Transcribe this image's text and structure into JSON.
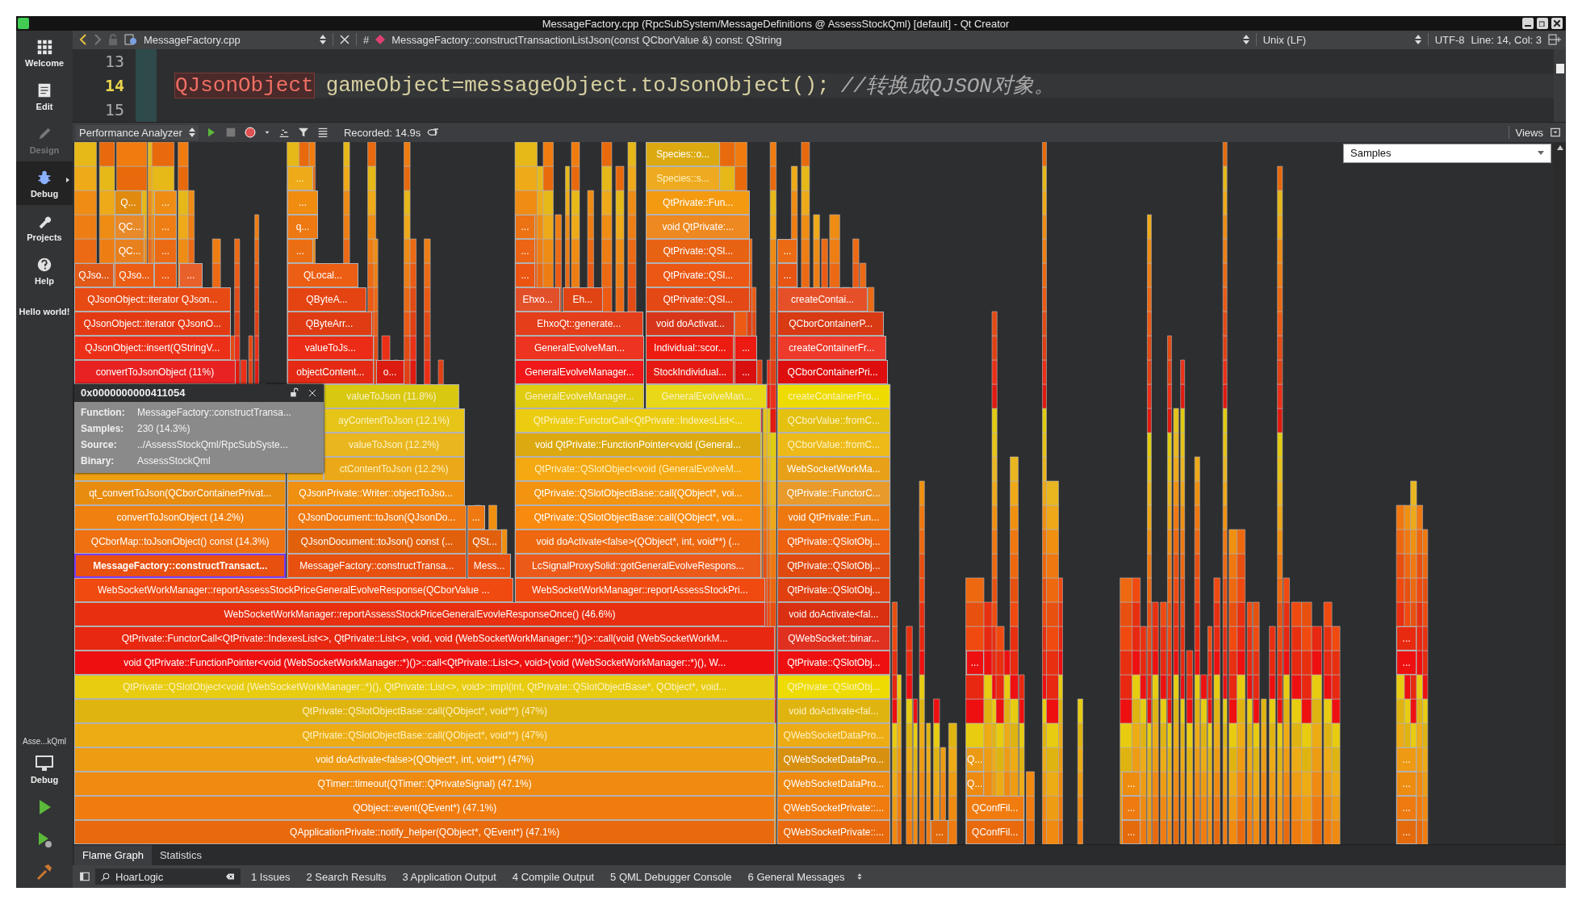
{
  "window": {
    "title": "MessageFactory.cpp (RpcSubSystem/MessageDefinitions @ AssessStockQml) [default] - Qt Creator"
  },
  "mode_bar": {
    "items": [
      {
        "label": "Welcome",
        "selected": false,
        "disabled": false
      },
      {
        "label": "Edit",
        "selected": false,
        "disabled": false
      },
      {
        "label": "Design",
        "selected": false,
        "disabled": true
      },
      {
        "label": "Debug",
        "selected": true,
        "disabled": false
      },
      {
        "label": "Projects",
        "selected": false,
        "disabled": false
      },
      {
        "label": "Help",
        "selected": false,
        "disabled": false
      }
    ],
    "note": "Hello world!",
    "target": {
      "project": "Asse...kQml",
      "config": "Debug"
    }
  },
  "editor_toolbar": {
    "file": "MessageFactory.cpp",
    "hash": "#",
    "symbol": "MessageFactory::constructTransactionListJson(const QCborValue &) const: QString",
    "line_ending": "Unix (LF)",
    "encoding": "UTF-8",
    "position": "Line: 14, Col: 3"
  },
  "code": {
    "lines": [
      {
        "number": "13",
        "current": false
      },
      {
        "number": "14",
        "current": true,
        "tokens": [
          {
            "kind": "type",
            "text": "QJsonObject"
          },
          {
            "kind": "plain",
            "text": "gameObject=messageObject.toJsonObject();"
          },
          {
            "kind": "comment",
            "text": "//转换成QJSON对象。"
          }
        ]
      },
      {
        "number": "15",
        "current": false
      }
    ]
  },
  "perf_toolbar": {
    "tool": "Performance Analyzer",
    "recorded": "Recorded: 14.9s",
    "views": "Views"
  },
  "flame_graph": {
    "mode": "Samples",
    "rows": [
      {
        "frames": [
          {
            "label": "Species::o...",
            "color": "#dcaa10",
            "selected": false
          }
        ]
      },
      {
        "frames": [
          {
            "label": "...",
            "color": "#eeaa18",
            "selected": false
          },
          {
            "label": "Species::s...",
            "color": "#eeaa20",
            "selected": false
          }
        ]
      },
      {
        "frames": [
          {
            "label": "Q...",
            "color": "#e08a10",
            "selected": false
          },
          {
            "label": "...",
            "color": "#ee8c14",
            "selected": false
          },
          {
            "label": "...",
            "color": "#f08c10",
            "selected": false
          },
          {
            "label": "QtPrivate::Fun...",
            "color": "#f49a10",
            "selected": false
          }
        ]
      },
      {
        "frames": [
          {
            "label": "QC...",
            "color": "#e88a2a",
            "selected": false
          },
          {
            "label": "...",
            "color": "#ee7e14",
            "selected": false
          },
          {
            "label": "q...",
            "color": "#ee7812",
            "selected": false
          },
          {
            "label": "...",
            "color": "#ec7214",
            "selected": false
          },
          {
            "label": "void QtPrivate:...",
            "color": "#ee8820",
            "selected": false
          }
        ]
      },
      {
        "frames": [
          {
            "label": "QC...",
            "color": "#e8801e",
            "selected": false
          },
          {
            "label": "...",
            "color": "#ec6a14",
            "selected": false
          },
          {
            "label": "...",
            "color": "#ec6e12",
            "selected": false
          },
          {
            "label": "...",
            "color": "#ec6414",
            "selected": false
          },
          {
            "label": "QtPrivate::QSl...",
            "color": "#e86214",
            "selected": false
          },
          {
            "label": "...",
            "color": "#ec6a14",
            "selected": false
          }
        ]
      },
      {
        "frames": [
          {
            "label": "QJso...",
            "color": "#e25a18",
            "selected": false
          },
          {
            "label": "QJso...",
            "color": "#ec5e14",
            "selected": false
          },
          {
            "label": "...",
            "color": "#ec5a14",
            "selected": false
          },
          {
            "label": "...",
            "color": "#e8602a",
            "selected": false
          },
          {
            "label": "QLocal...",
            "color": "#ec5e14",
            "selected": false
          },
          {
            "label": "...",
            "color": "#ec5412",
            "selected": false
          },
          {
            "label": "QtPrivate::QSl...",
            "color": "#ec5814",
            "selected": false
          },
          {
            "label": "...",
            "color": "#e85414",
            "selected": false
          }
        ]
      },
      {
        "frames": [
          {
            "label": "QJsonObject::iterator QJson...",
            "color": "#e84a14",
            "selected": false
          },
          {
            "label": "QByteA...",
            "color": "#e44412",
            "selected": false
          },
          {
            "label": "Ehxo...",
            "color": "#e2502a",
            "selected": false
          },
          {
            "label": "Eh...",
            "color": "#e04414",
            "selected": false
          },
          {
            "label": "QtPrivate::QSl...",
            "color": "#e44814",
            "selected": false
          },
          {
            "label": "createContai...",
            "color": "#e65028",
            "selected": false
          }
        ]
      },
      {
        "frames": [
          {
            "label": "QJsonObject::iterator QJsonO...",
            "color": "#e43a14",
            "selected": false
          },
          {
            "label": "QByteArr...",
            "color": "#e03c14",
            "selected": false
          },
          {
            "label": "EhxoQt::generate...",
            "color": "#e43e1a",
            "selected": false
          },
          {
            "label": "void doActivat...",
            "color": "#d8361a",
            "selected": false
          },
          {
            "label": "QCborContainerP...",
            "color": "#d83a14",
            "selected": false
          }
        ]
      },
      {
        "frames": [
          {
            "label": "QJsonObject::insert(QStringV...",
            "color": "#ec3018",
            "selected": false
          },
          {
            "label": "valueToJs...",
            "color": "#ec2c16",
            "selected": false
          },
          {
            "label": "GeneralEvolveMan...",
            "color": "#ec3420",
            "selected": false
          },
          {
            "label": "Individual::scor...",
            "color": "#ec1c10",
            "selected": false
          },
          {
            "label": "...",
            "color": "#ec1a10",
            "selected": false
          },
          {
            "label": "createContainerFr...",
            "color": "#ee3a2a",
            "selected": false
          }
        ]
      },
      {
        "frames": [
          {
            "label": "convertToJsonObject (11%)",
            "color": "#e82222",
            "selected": false
          },
          {
            "label": "objectContent...",
            "color": "#e42a14",
            "selected": false
          },
          {
            "label": "o...",
            "color": "#dc1c10",
            "selected": false
          },
          {
            "label": "GeneralEvolveManager...",
            "color": "#f01818",
            "selected": false
          },
          {
            "label": "StockIndividual...",
            "color": "#e41a12",
            "selected": false
          },
          {
            "label": "...",
            "color": "#d81010",
            "selected": false
          },
          {
            "label": "QCborContainerPri...",
            "color": "#de0e0e",
            "selected": false
          }
        ]
      },
      {
        "frames": [
          {
            "label": "valueToJson (11.8%)",
            "color": "#d8c810",
            "selected": false
          },
          {
            "label": "GeneralEvolveManager...",
            "color": "#e0cc10",
            "selected": false
          },
          {
            "label": "GeneralEvolveMan...",
            "color": "#e8d818",
            "selected": false
          },
          {
            "label": "createContainerFro...",
            "color": "#eedc00",
            "selected": false
          }
        ]
      },
      {
        "frames": [
          {
            "label": "ayContentToJson (12.1%)",
            "color": "#e6c418",
            "selected": false
          },
          {
            "label": "QtPrivate::FunctorCall<QtPrivate::IndexesList<...",
            "color": "#eccc10",
            "selected": false
          },
          {
            "label": "QCborValue::fromC...",
            "color": "#e4c010",
            "selected": false
          }
        ]
      },
      {
        "frames": [
          {
            "label": "valueToJson (12.2%)",
            "color": "#eab620",
            "selected": false
          },
          {
            "label": "void QtPrivate::FunctionPointer<void (General...",
            "color": "#dcaa10",
            "selected": false
          },
          {
            "label": "QCborValue::fromC...",
            "color": "#eeba18",
            "selected": false
          }
        ]
      },
      {
        "frames": [
          {
            "color": "#eea010",
            "selected": false
          },
          {
            "color": "#eba818",
            "selected": false
          },
          {
            "label": "ctContentToJson (12.2%)",
            "color": "#eba818",
            "selected": false
          },
          {
            "label": "QtPrivate::QSlotObject<void (GeneralEvolveM...",
            "color": "#f4a812",
            "selected": false
          },
          {
            "label": "WebSocketWorkMa...",
            "color": "#e8a018",
            "selected": false
          }
        ]
      },
      {
        "frames": [
          {
            "label": "qt_convertToJson(QCborContainerPrivat...",
            "color": "#e88c10",
            "selected": false
          },
          {
            "label": "QJsonPrivate::Writer::objectToJso...",
            "color": "#ef9010",
            "selected": false
          },
          {
            "label": "QtPrivate::QSlotObjectBase::call(QObject*, voi...",
            "color": "#f39410",
            "selected": false
          },
          {
            "label": "QtPrivate::FunctorC...",
            "color": "#e89a2a",
            "selected": false
          }
        ]
      },
      {
        "frames": [
          {
            "label": "convertToJsonObject (14.2%)",
            "color": "#f08010",
            "selected": false
          },
          {
            "label": "QJsonDocument::toJson(QJsonDo...",
            "color": "#ef7810",
            "selected": false
          },
          {
            "label": "...",
            "color": "#ef7810",
            "selected": false
          },
          {
            "label": "QtPrivate::QSlotObjectBase::call(QObject*, voi...",
            "color": "#f88a10",
            "selected": false
          },
          {
            "label": "void QtPrivate::Fun...",
            "color": "#ee7810",
            "selected": false
          }
        ]
      },
      {
        "frames": [
          {
            "label": "QCborMap::toJsonObject() const (14.3%)",
            "color": "#ee7010",
            "selected": false
          },
          {
            "label": "QJsonDocument::toJson() const (...",
            "color": "#e0600c",
            "selected": false
          },
          {
            "label": "QSt...",
            "color": "#e0600c",
            "selected": false
          },
          {
            "label": "void doActivate<false>(QObject*, int, void**) (...",
            "color": "#ee6810",
            "selected": false
          },
          {
            "label": "QtPrivate::QSlotObj...",
            "color": "#ec6010",
            "selected": false
          }
        ]
      },
      {
        "frames": [
          {
            "label": "MessageFactory::constructTransact...",
            "color": "#e85010",
            "selected": true
          },
          {
            "label": "MessageFactory::constructTransa...",
            "color": "#e85010",
            "selected": false
          },
          {
            "label": "Mess...",
            "color": "#e85010",
            "selected": false
          },
          {
            "label": "LcSignalProxySolid::gotGeneralEvolveRespons...",
            "color": "#ec5a1a",
            "selected": false
          },
          {
            "label": "QtPrivate::QSlotObj...",
            "color": "#e04a10",
            "selected": false
          }
        ]
      },
      {
        "frames": [
          {
            "label": "WebSocketWorkManager::reportAssessStockPriceGeneralEvolveResponse(QCborValue ...",
            "color": "#f04a10",
            "selected": false
          },
          {
            "label": "WebSocketWorkManager::reportAssessStockPri...",
            "color": "#f04a10",
            "selected": false
          },
          {
            "label": "QtPrivate::QSlotObj...",
            "color": "#e04010",
            "selected": false
          }
        ]
      },
      {
        "frames": [
          {
            "label": "WebSocketWorkManager::reportAssessStockPriceGeneralEvovleResponseOnce() (46.6%)",
            "color": "#e83010",
            "selected": false
          },
          {
            "label": "void doActivate<fal...",
            "color": "#d83010",
            "selected": false
          }
        ]
      },
      {
        "frames": [
          {
            "label": "QtPrivate::FunctorCall<QtPrivate::IndexesList<>, QtPrivate::List<>, void, void (WebSocketWorkManager::*)()>::call(void (WebSocketWorkM...",
            "color": "#e82810",
            "selected": false
          },
          {
            "label": "QWebSocket::binar...",
            "color": "#e03020",
            "selected": false
          },
          {
            "label": "...",
            "color": "#e82a10",
            "selected": false
          }
        ]
      },
      {
        "frames": [
          {
            "label": "void QtPrivate::FunctionPointer<void (WebSocketWorkManager::*)()>::call<QtPrivate::List<>, void>(void (WebSocketWorkManager::*)(), W...",
            "color": "#ee1010",
            "selected": false
          },
          {
            "label": "QtPrivate::QSlotObj...",
            "color": "#ee1010",
            "selected": false
          },
          {
            "label": "...",
            "color": "#ee1010",
            "selected": false
          },
          {
            "label": "...",
            "color": "#ee1010",
            "selected": false
          }
        ]
      },
      {
        "frames": [
          {
            "label": "QtPrivate::QSlotObject<void (WebSocketWorkManager::*)(), QtPrivate::List<>, void>::impl(int, QtPrivate::QSlotObjectBase*, QObject*, void...",
            "color": "#e8cc10",
            "selected": false
          },
          {
            "label": "QtPrivate::QSlotObj...",
            "color": "#eedc00",
            "selected": false
          }
        ]
      },
      {
        "frames": [
          {
            "label": "QtPrivate::QSlotObjectBase::call(QObject*, void**) (47%)",
            "color": "#e0b410",
            "selected": false
          },
          {
            "label": "void doActivate<fal...",
            "color": "#e0b410",
            "selected": false
          }
        ]
      },
      {
        "frames": [
          {
            "label": "QtPrivate::QSlotObjectBase::call(QObject*, void**) (47%)",
            "color": "#eeac14",
            "selected": false
          },
          {
            "label": "QWebSocketDataPro...",
            "color": "#eeac14",
            "selected": false
          }
        ]
      },
      {
        "frames": [
          {
            "label": "void doActivate<false>(QObject*, int, void**) (47%)",
            "color": "#ee9c12",
            "selected": false
          },
          {
            "label": "QWebSocketDataPro...",
            "color": "#d89010",
            "selected": false
          },
          {
            "label": "Q...",
            "color": "#ec9a14",
            "selected": false
          },
          {
            "label": "...",
            "color": "#ee9a12",
            "selected": false
          }
        ]
      },
      {
        "frames": [
          {
            "label": "QTimer::timeout(QTimer::QPrivateSignal) (47.1%)",
            "color": "#f08a10",
            "selected": false
          },
          {
            "label": "QWebSocketDataPro...",
            "color": "#f08a10",
            "selected": false
          },
          {
            "label": "Q...",
            "color": "#ee8a10",
            "selected": false
          },
          {
            "label": "...",
            "color": "#ee8c10",
            "selected": false
          },
          {
            "label": "...",
            "color": "#ee8c10",
            "selected": false
          }
        ]
      },
      {
        "frames": [
          {
            "label": "QObject::event(QEvent*) (47.1%)",
            "color": "#f07c10",
            "selected": false
          },
          {
            "label": "QWebSocketPrivate::...",
            "color": "#f07c10",
            "selected": false
          },
          {
            "label": "QConfFil...",
            "color": "#f07c10",
            "selected": false
          },
          {
            "label": "...",
            "color": "#ee7a10",
            "selected": false
          },
          {
            "label": "...",
            "color": "#ee7a10",
            "selected": false
          }
        ]
      },
      {
        "frames": [
          {
            "label": "QApplicationPrivate::notify_helper(QObject*, QEvent*) (47.1%)",
            "color": "#e86a0c",
            "selected": false
          },
          {
            "label": "QWebSocketPrivate::...",
            "color": "#e86a0c",
            "selected": false
          },
          {
            "label": "...",
            "color": "#e06a0c",
            "selected": false
          },
          {
            "label": "QConfFil...",
            "color": "#e86a0c",
            "selected": false
          },
          {
            "label": "...",
            "color": "#e46a0c",
            "selected": false
          },
          {
            "label": "...",
            "color": "#e46a0c",
            "selected": false
          }
        ]
      }
    ],
    "tooltip": {
      "address": "0x0000000000411054",
      "fields": [
        {
          "label": "Function:",
          "value": "MessageFactory::constructTransa..."
        },
        {
          "label": "Samples:",
          "value": "230 (14.3%)"
        },
        {
          "label": "Source:",
          "value": "../AssessStockQml/RpcSubSyste..."
        },
        {
          "label": "Binary:",
          "value": "AssessStockQml"
        }
      ]
    }
  },
  "view_tabs": [
    {
      "label": "Flame Graph",
      "selected": true
    },
    {
      "label": "Statistics",
      "selected": false
    }
  ],
  "status_bar": {
    "locator": {
      "value": "HoarLogic"
    },
    "panes": [
      {
        "number": "1",
        "label": "Issues"
      },
      {
        "number": "2",
        "label": "Search Results"
      },
      {
        "number": "3",
        "label": "Application Output"
      },
      {
        "number": "4",
        "label": "Compile Output"
      },
      {
        "number": "5",
        "label": "QML Debugger Console"
      },
      {
        "number": "6",
        "label": "General Messages"
      }
    ]
  }
}
